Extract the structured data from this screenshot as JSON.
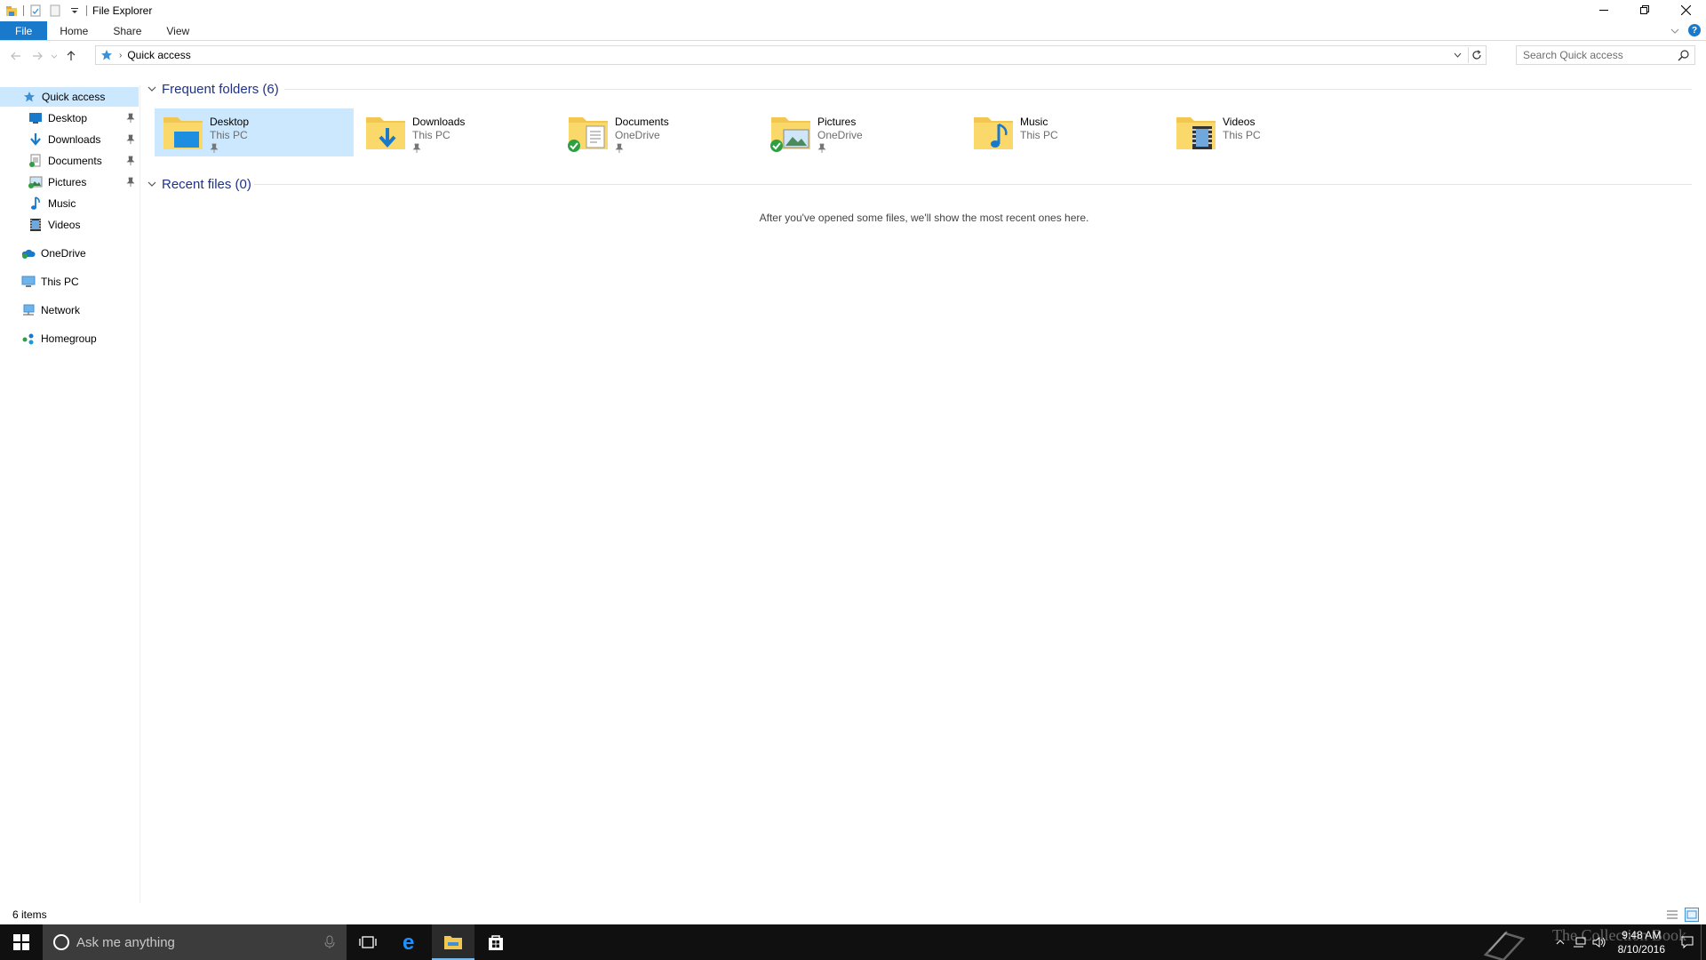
{
  "window": {
    "title": "File Explorer"
  },
  "ribbon": {
    "tabs": [
      "File",
      "Home",
      "Share",
      "View"
    ]
  },
  "address": {
    "crumb": "Quick access"
  },
  "search": {
    "placeholder": "Search Quick access"
  },
  "nav": {
    "quick_access": "Quick access",
    "items": [
      {
        "label": "Desktop",
        "icon": "desktop-icon",
        "pinned": true
      },
      {
        "label": "Downloads",
        "icon": "download-arrow-icon",
        "pinned": true
      },
      {
        "label": "Documents",
        "icon": "documents-icon",
        "pinned": true
      },
      {
        "label": "Pictures",
        "icon": "pictures-icon",
        "pinned": true
      },
      {
        "label": "Music",
        "icon": "music-note-icon",
        "pinned": false
      },
      {
        "label": "Videos",
        "icon": "videos-icon",
        "pinned": false
      }
    ],
    "roots": [
      {
        "label": "OneDrive",
        "icon": "onedrive-icon"
      },
      {
        "label": "This PC",
        "icon": "this-pc-icon"
      },
      {
        "label": "Network",
        "icon": "network-icon"
      },
      {
        "label": "Homegroup",
        "icon": "homegroup-icon"
      }
    ]
  },
  "frequent": {
    "header": "Frequent folders (6)",
    "folders": [
      {
        "name": "Desktop",
        "location": "This PC",
        "pinned": true,
        "synced": false
      },
      {
        "name": "Downloads",
        "location": "This PC",
        "pinned": true,
        "synced": false
      },
      {
        "name": "Documents",
        "location": "OneDrive",
        "pinned": true,
        "synced": true
      },
      {
        "name": "Pictures",
        "location": "OneDrive",
        "pinned": true,
        "synced": true
      },
      {
        "name": "Music",
        "location": "This PC",
        "pinned": false,
        "synced": false
      },
      {
        "name": "Videos",
        "location": "This PC",
        "pinned": false,
        "synced": false
      }
    ]
  },
  "recent": {
    "header": "Recent files (0)",
    "empty_message": "After you've opened some files, we'll show the most recent ones here."
  },
  "status": {
    "items": "6 items"
  },
  "taskbar": {
    "search_placeholder": "Ask me anything",
    "time": "9:48 AM",
    "date": "8/10/2016",
    "watermark": "The Collection Book"
  },
  "colors": {
    "accent": "#1979ca",
    "selection": "#cce8ff",
    "group_header": "#1e3287",
    "taskbar": "#101010"
  }
}
